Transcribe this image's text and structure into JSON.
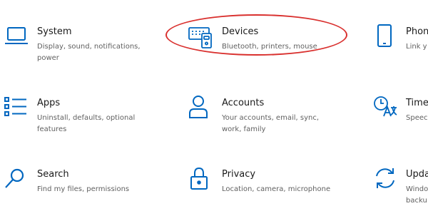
{
  "colors": {
    "accent": "#0067c0",
    "highlight": "#d9302e"
  },
  "tiles": [
    {
      "title": "System",
      "desc": "Display, sound, notifications,\npower",
      "icon": "laptop-icon"
    },
    {
      "title": "Devices",
      "desc": "Bluetooth, printers, mouse",
      "icon": "keyboard-device-icon"
    },
    {
      "title": "Phone",
      "desc": "Link y",
      "icon": "phone-icon"
    },
    {
      "title": "Apps",
      "desc": "Uninstall, defaults, optional\nfeatures",
      "icon": "apps-list-icon"
    },
    {
      "title": "Accounts",
      "desc": "Your accounts, email, sync,\nwork, family",
      "icon": "person-icon"
    },
    {
      "title": "Time",
      "desc": "Speec",
      "icon": "time-language-icon"
    },
    {
      "title": "Search",
      "desc": "Find my files, permissions",
      "icon": "search-icon"
    },
    {
      "title": "Privacy",
      "desc": "Location, camera, microphone",
      "icon": "lock-icon"
    },
    {
      "title": "Upda",
      "desc": "Windo\nbacku",
      "icon": "update-icon"
    }
  ]
}
